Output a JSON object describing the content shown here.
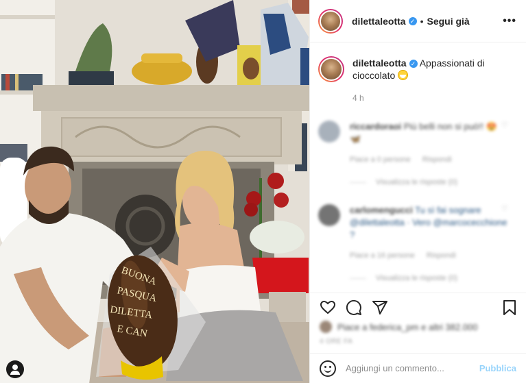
{
  "post": {
    "author": "dilettaleotta",
    "follow_status": "Segui già",
    "more_label": "•••",
    "caption": "Appassionati di cioccolato",
    "time_ago": "4 h",
    "photo_egg_text": "BUONA PASQUA DILETTA E CAN",
    "user_tag_icon": "person-icon"
  },
  "comments": [
    {
      "user": "riccardoraoi",
      "text": "Più belli non si può!! 😍🦋",
      "likes": "Piace a 0 persone",
      "reply": "Rispondi",
      "view_replies": "Visualizza le risposte (0)"
    },
    {
      "user": "carlomengucci",
      "text": "Tu sì fai sognare @dilettaleotta · Vero @marcocecchione ?",
      "likes": "Piace a 16 persone",
      "reply": "Rispondi",
      "view_replies": "Visualizza le risposte (0)"
    }
  ],
  "footer": {
    "likes_text": "Piace a federica_pm e altri 382.000",
    "date": "4 ORE FA",
    "comment_placeholder": "Aggiungi un commento...",
    "publish_label": "Pubblica"
  },
  "colors": {
    "accent_blue": "#0095f6",
    "verified": "#3897f0",
    "muted": "#8e8e8e"
  }
}
